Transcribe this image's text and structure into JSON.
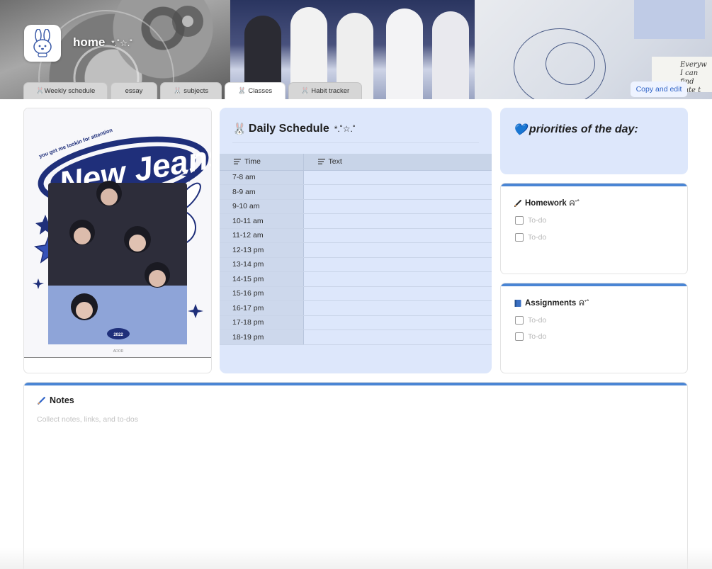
{
  "header": {
    "title": "home",
    "title_decor": "*.˚☆.˚",
    "copy_button": "Copy and edit",
    "sketch_text_1": "Everyw",
    "sketch_text_2": "I can find",
    "sketch_text_3": "cute t"
  },
  "tabs": [
    {
      "label": "🐰Weekly schedule"
    },
    {
      "label": "essay"
    },
    {
      "label": "🐰 subjects"
    },
    {
      "label": "🐰 Classes",
      "active": true
    },
    {
      "label": "🐰 Habit tracker"
    }
  ],
  "poster": {
    "headline": "New Jeans",
    "tagline": "you got me lookin for attention",
    "year": "2022",
    "label": "ADOR"
  },
  "schedule": {
    "title": "Daily Schedule",
    "title_icon": "🐰",
    "title_decor": "*.˚☆.˚",
    "columns": [
      "Time",
      "Text"
    ],
    "rows": [
      {
        "time": "7-8 am",
        "text": ""
      },
      {
        "time": "8-9 am",
        "text": ""
      },
      {
        "time": "9-10 am",
        "text": ""
      },
      {
        "time": "10-11 am",
        "text": ""
      },
      {
        "time": "11-12 am",
        "text": ""
      },
      {
        "time": "12-13 pm",
        "text": ""
      },
      {
        "time": "13-14 pm",
        "text": ""
      },
      {
        "time": "14-15 pm",
        "text": ""
      },
      {
        "time": "15-16 pm",
        "text": ""
      },
      {
        "time": "16-17 pm",
        "text": ""
      },
      {
        "time": "17-18 pm",
        "text": ""
      },
      {
        "time": "18-19 pm",
        "text": ""
      }
    ]
  },
  "priorities": {
    "icon": "💙",
    "title": "priorities of the day:"
  },
  "homework": {
    "title": "Homework",
    "decor": "ᕱ⁺˚",
    "items": [
      "To-do",
      "To-do"
    ]
  },
  "assignments": {
    "title": "Assignments",
    "decor": "ᕱ⁺˚",
    "items": [
      "To-do",
      "To-do"
    ]
  },
  "notes": {
    "title": "Notes",
    "placeholder": "Collect notes, links, and to-dos"
  },
  "colors": {
    "accent": "#4a85d4",
    "card_blue": "#dde7fb",
    "button_text": "#2f63c7"
  }
}
